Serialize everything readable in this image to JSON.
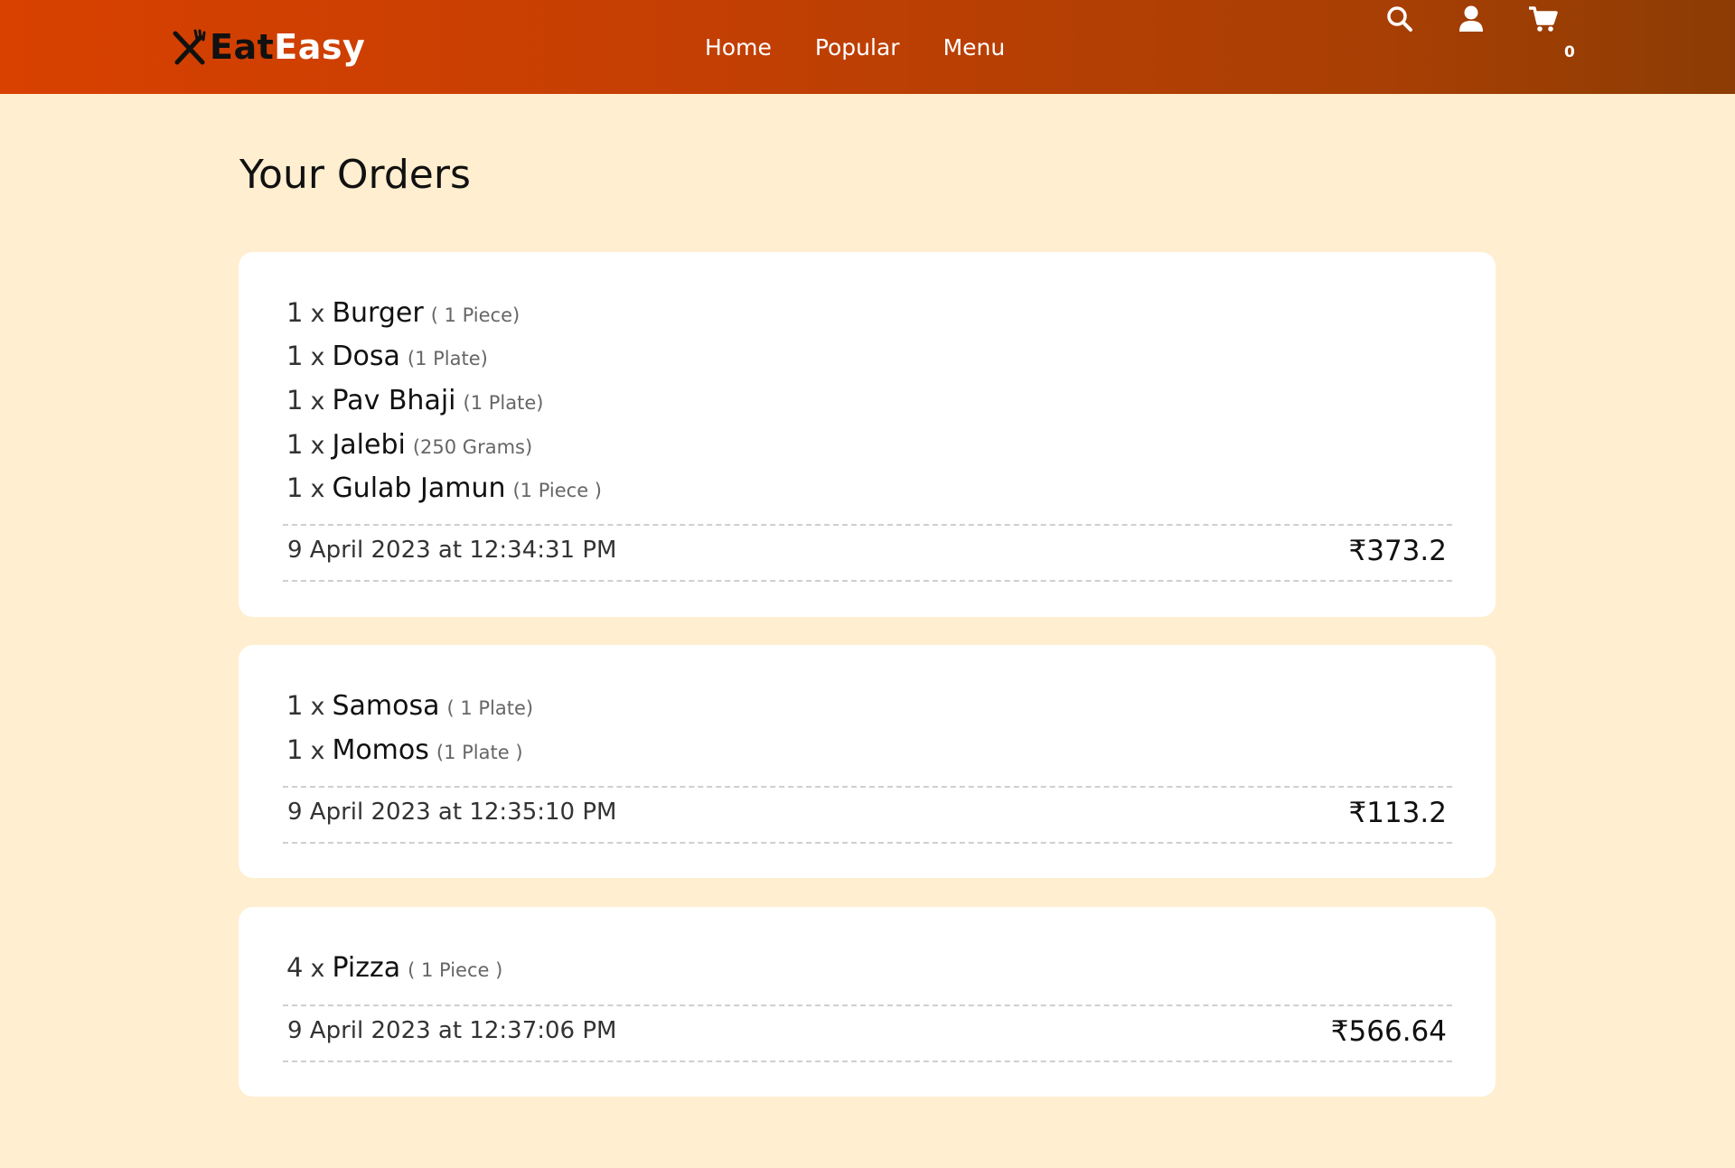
{
  "brand": {
    "part1": "Eat",
    "part2": "Easy",
    "logo_icon": "fork-knife-icon"
  },
  "nav": {
    "links": [
      "Home",
      "Popular",
      "Menu"
    ],
    "cart_count": "0",
    "icons": [
      "search-icon",
      "user-icon",
      "cart-icon"
    ]
  },
  "colors": {
    "header_start": "#d84100",
    "header_end": "#8c3c04",
    "page_bg": "#ffeecf",
    "card_bg": "#ffffff"
  },
  "page_title": "Your Orders",
  "orders": [
    {
      "items": [
        {
          "qty": "1",
          "sep": "x",
          "name": "Burger",
          "unit": "( 1 Piece)"
        },
        {
          "qty": "1",
          "sep": "x",
          "name": "Dosa",
          "unit": "(1 Plate)"
        },
        {
          "qty": "1",
          "sep": "x",
          "name": "Pav Bhaji",
          "unit": "(1 Plate)"
        },
        {
          "qty": "1",
          "sep": "x",
          "name": "Jalebi",
          "unit": "(250 Grams)"
        },
        {
          "qty": "1",
          "sep": "x",
          "name": "Gulab Jamun",
          "unit": "(1 Piece )"
        }
      ],
      "timestamp": "9 April 2023 at 12:34:31 PM",
      "total": "₹373.2"
    },
    {
      "items": [
        {
          "qty": "1",
          "sep": "x",
          "name": "Samosa",
          "unit": "( 1 Plate)"
        },
        {
          "qty": "1",
          "sep": "x",
          "name": "Momos",
          "unit": "(1 Plate )"
        }
      ],
      "timestamp": "9 April 2023 at 12:35:10 PM",
      "total": "₹113.2"
    },
    {
      "items": [
        {
          "qty": "4",
          "sep": "x",
          "name": "Pizza",
          "unit": "( 1 Piece )"
        }
      ],
      "timestamp": "9 April 2023 at 12:37:06 PM",
      "total": "₹566.64"
    }
  ]
}
